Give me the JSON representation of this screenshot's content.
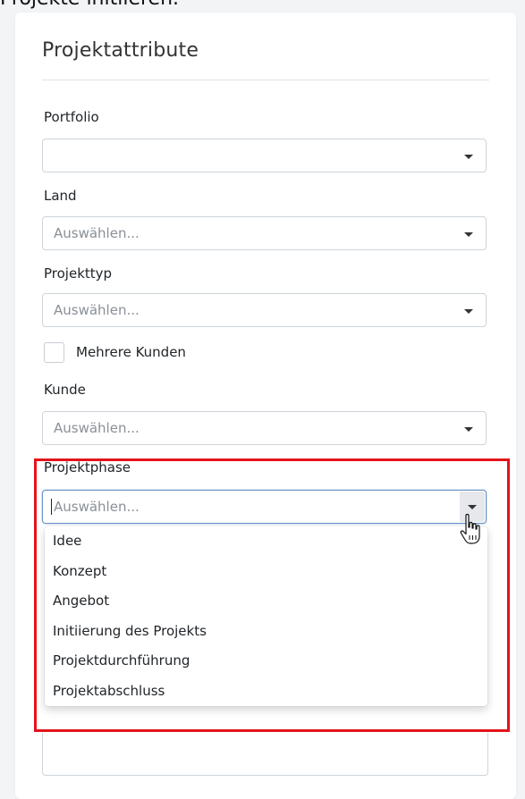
{
  "page": {
    "partial_title": "Projekte initiieren."
  },
  "card": {
    "title": "Projektattribute"
  },
  "fields": {
    "portfolio": {
      "label": "Portfolio",
      "placeholder": ""
    },
    "land": {
      "label": "Land",
      "placeholder": "Auswählen..."
    },
    "projekttyp": {
      "label": "Projekttyp",
      "placeholder": "Auswählen..."
    },
    "mehrere_kunden": {
      "label": "Mehrere Kunden",
      "checked": false
    },
    "kunde": {
      "label": "Kunde",
      "placeholder": "Auswählen..."
    },
    "projektphase": {
      "label": "Projektphase",
      "placeholder": "Auswählen...",
      "open": true,
      "options": [
        "Idee",
        "Konzept",
        "Angebot",
        "Initiierung des Projekts",
        "Projektdurchführung",
        "Projektabschluss"
      ]
    }
  },
  "colors": {
    "highlight": "#e3131b",
    "focus_border": "#6c94c7",
    "placeholder": "#8a9097"
  },
  "icons": {
    "dropdown": "caret-down-icon",
    "cursor": "hand-pointer-icon"
  }
}
